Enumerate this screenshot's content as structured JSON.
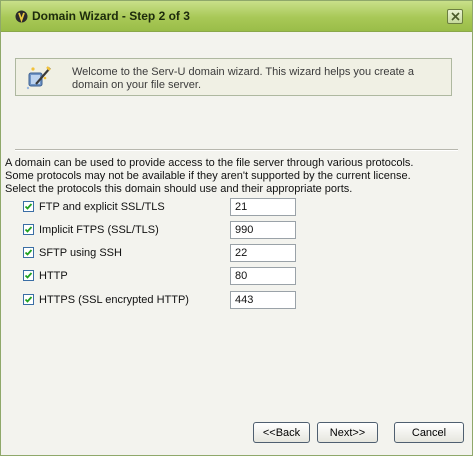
{
  "window": {
    "title": "Domain Wizard - Step 2 of 3",
    "accent": "#a8c857"
  },
  "welcome": {
    "text": "Welcome to the Serv-U domain wizard. This wizard helps you create a domain on your file server."
  },
  "description": {
    "lines": [
      "A domain can be used to provide access to the file server through various protocols.",
      "Some protocols may not be available if they aren't supported by the current license.",
      "Select the protocols this domain should use and their appropriate ports."
    ]
  },
  "protocols": [
    {
      "label": "FTP and explicit SSL/TLS",
      "checked": true,
      "port": "21"
    },
    {
      "label": "Implicit FTPS (SSL/TLS)",
      "checked": true,
      "port": "990"
    },
    {
      "label": "SFTP using SSH",
      "checked": true,
      "port": "22"
    },
    {
      "label": "HTTP",
      "checked": true,
      "port": "80"
    },
    {
      "label": "HTTPS (SSL encrypted HTTP)",
      "checked": true,
      "port": "443"
    }
  ],
  "buttons": {
    "back": "<<Back",
    "next": "Next>>",
    "cancel": "Cancel"
  }
}
